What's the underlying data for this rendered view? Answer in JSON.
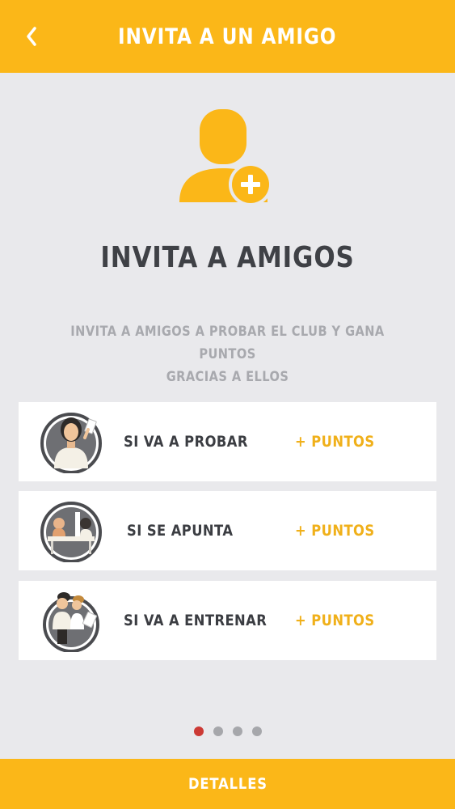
{
  "header": {
    "title": "INVITA A UN AMIGO",
    "back_icon": "chevron-left-icon"
  },
  "hero": {
    "icon": "add-user-icon",
    "heading": "INVITA A AMIGOS",
    "subtitle_line1": "INVITA A AMIGOS A PROBAR EL CLUB Y GANA PUNTOS",
    "subtitle_line2": "GRACIAS A ELLOS"
  },
  "rewards": [
    {
      "label": "SI VA A PROBAR",
      "points": "+ PUNTOS",
      "icon": "woman-trying-club-icon"
    },
    {
      "label": "SI SE APUNTA",
      "points": "+ PUNTOS",
      "icon": "signing-up-at-desk-icon"
    },
    {
      "label": "SI VA A ENTRENAR",
      "points": "+ PUNTOS",
      "icon": "friends-training-icon"
    }
  ],
  "pager": {
    "current": 1,
    "total": 4
  },
  "footer": {
    "details_label": "DETALLES"
  },
  "colors": {
    "accent": "#fbb718",
    "points": "#f0b01a",
    "heading": "#3f4146",
    "subtitle": "#a8a9ae",
    "background": "#e9e9ec",
    "active_dot": "#cc3a35"
  }
}
